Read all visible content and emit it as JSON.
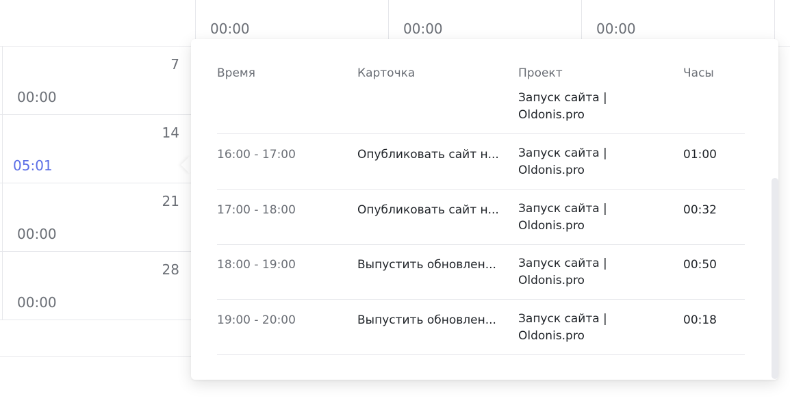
{
  "calendar": {
    "header_totals": [
      "00:00",
      "00:00",
      "00:00"
    ],
    "header_partial_nums": [
      "",
      "",
      ""
    ],
    "weeks": [
      {
        "day": "7",
        "total": "00:00"
      },
      {
        "day": "14",
        "total": "05:01"
      },
      {
        "day": "21",
        "total": "00:00"
      },
      {
        "day": "28",
        "total": "00:00"
      }
    ]
  },
  "popover": {
    "columns": {
      "time": "Время",
      "card": "Карточка",
      "project": "Проект",
      "hours": "Часы"
    },
    "rows": [
      {
        "time": "",
        "card": "",
        "project_line1": "Запуск сайта |",
        "project_line2": "Oldonis.pro",
        "hours": ""
      },
      {
        "time": "16:00 - 17:00",
        "card": "Опубликовать сайт н...",
        "project_line1": "Запуск сайта |",
        "project_line2": "Oldonis.pro",
        "hours": "01:00"
      },
      {
        "time": "17:00 - 18:00",
        "card": "Опубликовать сайт н...",
        "project_line1": "Запуск сайта |",
        "project_line2": "Oldonis.pro",
        "hours": "00:32"
      },
      {
        "time": "18:00 - 19:00",
        "card": "Выпустить обновлен...",
        "project_line1": "Запуск сайта |",
        "project_line2": "Oldonis.pro",
        "hours": "00:50"
      },
      {
        "time": "19:00 - 20:00",
        "card": "Выпустить обновлен...",
        "project_line1": "Запуск сайта |",
        "project_line2": "Oldonis.pro",
        "hours": "00:18"
      }
    ]
  },
  "colors": {
    "accent": "#5b6ee6",
    "muted_text": "#6b6f76",
    "border": "#e6e7eb"
  }
}
